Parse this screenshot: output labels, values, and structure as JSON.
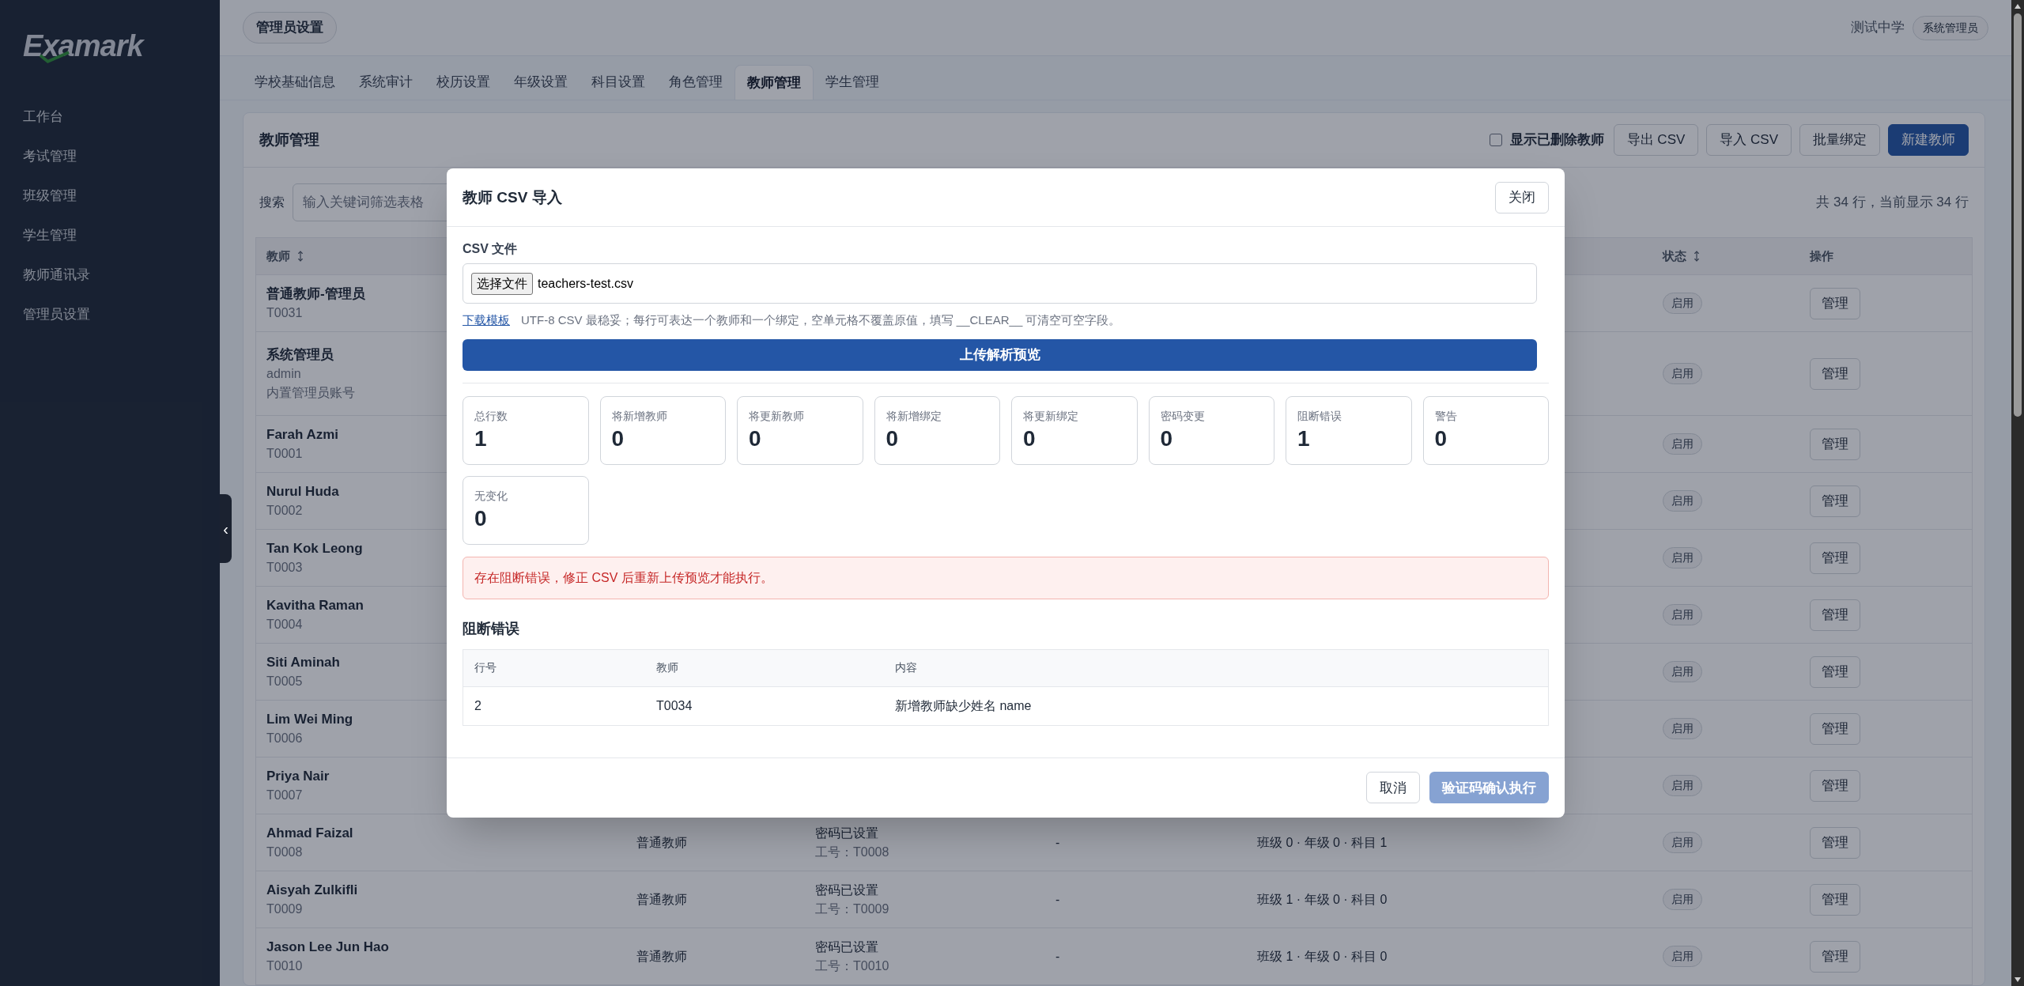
{
  "logo": "Examark",
  "sidebar": {
    "items": [
      {
        "label": "工作台",
        "selected": false
      },
      {
        "label": "考试管理",
        "selected": false
      },
      {
        "label": "班级管理",
        "selected": false
      },
      {
        "label": "学生管理",
        "selected": false
      },
      {
        "label": "教师通讯录",
        "selected": false
      },
      {
        "label": "管理员设置",
        "selected": false
      }
    ],
    "toggle": "‹"
  },
  "header": {
    "page_title": "管理员设置",
    "school": "测试中学",
    "role": "系统管理员"
  },
  "tabs": [
    {
      "label": "学校基础信息",
      "selected": false
    },
    {
      "label": "系统审计",
      "selected": false
    },
    {
      "label": "校历设置",
      "selected": false
    },
    {
      "label": "年级设置",
      "selected": false
    },
    {
      "label": "科目设置",
      "selected": false
    },
    {
      "label": "角色管理",
      "selected": false
    },
    {
      "label": "教师管理",
      "selected": true
    },
    {
      "label": "学生管理",
      "selected": false
    }
  ],
  "card": {
    "title": "教师管理",
    "show_deleted": {
      "label": "显示已删除教师",
      "checked": false
    },
    "buttons": [
      {
        "label": "导出 CSV",
        "kind": "plain"
      },
      {
        "label": "导入 CSV",
        "kind": "plain"
      },
      {
        "label": "批量绑定",
        "kind": "plain"
      },
      {
        "label": "新建教师",
        "kind": "primary"
      }
    ],
    "search": {
      "label": "搜索",
      "placeholder": "输入关键词筛选表格"
    },
    "count": "共 34 行，当前显示 34 行"
  },
  "table": {
    "columns": [
      {
        "label": "教师",
        "sortable": true
      },
      {
        "label": "状态",
        "sortable": true
      },
      {
        "label": "操作",
        "sortable": false
      }
    ],
    "rows": [
      {
        "name": "普通教师-管理员",
        "code": "T0031",
        "status": "启用",
        "action": "管理"
      },
      {
        "name": "系统管理员",
        "code": "admin",
        "note": "内置管理员账号",
        "status": "启用",
        "action": "管理"
      },
      {
        "name": "Farah Azmi",
        "code": "T0001",
        "status": "启用",
        "action": "管理"
      },
      {
        "name": "Nurul Huda",
        "code": "T0002",
        "status": "启用",
        "action": "管理"
      },
      {
        "name": "Tan Kok Leong",
        "code": "T0003",
        "status": "启用",
        "action": "管理"
      },
      {
        "name": "Kavitha Raman",
        "code": "T0004",
        "status": "启用",
        "action": "管理"
      },
      {
        "name": "Siti Aminah",
        "code": "T0005",
        "status": "启用",
        "action": "管理"
      },
      {
        "name": "Lim Wei Ming",
        "code": "T0006",
        "status": "启用",
        "action": "管理"
      },
      {
        "name": "Priya Nair",
        "code": "T0007",
        "status": "启用",
        "action": "管理"
      },
      {
        "name": "Ahmad Faizal",
        "code": "T0008",
        "role": "普通教师",
        "account": "密码已设置",
        "account_id": "工号：T0008",
        "column_4": "-",
        "bindings": "班级 0 · 年级 0 · 科目 1",
        "status": "启用",
        "action": "管理"
      },
      {
        "name": "Aisyah Zulkifli",
        "code": "T0009",
        "role": "普通教师",
        "account": "密码已设置",
        "account_id": "工号：T0009",
        "column_4": "-",
        "bindings": "班级 1 · 年级 0 · 科目 0",
        "status": "启用",
        "action": "管理"
      },
      {
        "name": "Jason Lee Jun Hao",
        "code": "T0010",
        "role": "普通教师",
        "account": "密码已设置",
        "account_id": "工号：T0010",
        "column_4": "-",
        "bindings": "班级 1 · 年级 0 · 科目 0",
        "status": "启用",
        "action": "管理"
      }
    ]
  },
  "dialog": {
    "title": "教师 CSV 导入",
    "close": "关闭",
    "file_label": "CSV 文件",
    "choose_file": "选择文件",
    "file_name": "teachers-test.csv",
    "template_link": "下载模板",
    "hint": "UTF-8 CSV 最稳妥；每行可表达一个教师和一个绑定，空单元格不覆盖原值，填写 __CLEAR__ 可清空可空字段。",
    "upload": "上传解析预览",
    "stats": [
      {
        "label": "总行数",
        "value": "1"
      },
      {
        "label": "将新增教师",
        "value": "0"
      },
      {
        "label": "将更新教师",
        "value": "0"
      },
      {
        "label": "将新增绑定",
        "value": "0"
      },
      {
        "label": "将更新绑定",
        "value": "0"
      },
      {
        "label": "密码变更",
        "value": "0"
      },
      {
        "label": "阻断错误",
        "value": "1"
      },
      {
        "label": "警告",
        "value": "0"
      },
      {
        "label": "无变化",
        "value": "0"
      }
    ],
    "alert": "存在阻断错误，修正 CSV 后重新上传预览才能执行。",
    "errors": {
      "title": "阻断错误",
      "columns": [
        "行号",
        "教师",
        "内容"
      ],
      "rows": [
        [
          "2",
          "T0034",
          "新增教师缺少姓名 name"
        ]
      ]
    },
    "cancel": "取消",
    "confirm": {
      "label": "验证码确认执行",
      "disabled": true
    }
  }
}
